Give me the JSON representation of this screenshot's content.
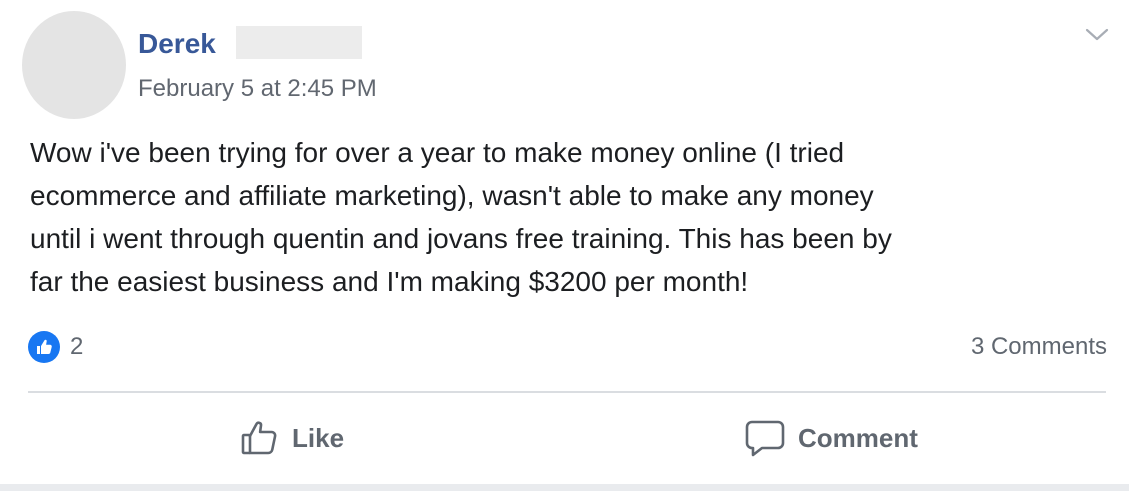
{
  "post": {
    "author_name": "Derek",
    "timestamp": "February 5 at 2:45 PM",
    "text_lines": [
      "Wow i've been trying for over a year to make money online (I tried",
      "ecommerce and affiliate marketing), wasn't able to make any money",
      "until i went through quentin and jovans free training. This has been by",
      "far the easiest business and I'm making $3200 per month!"
    ],
    "reactions": {
      "icon": "thumbs-up-icon",
      "count": "2"
    },
    "comments_count": "3 Comments",
    "actions": {
      "like_label": "Like",
      "comment_label": "Comment"
    }
  },
  "colors": {
    "author_name": "#385898",
    "secondary_text": "#616770",
    "like_badge": "#1877f2",
    "divider": "#dadde1"
  }
}
